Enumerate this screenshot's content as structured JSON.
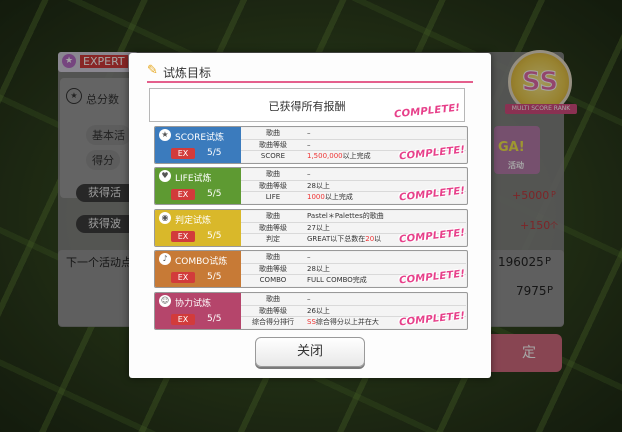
{
  "background": {
    "difficulty": "EXPERT",
    "score_title": "总分数",
    "pill_basic": "基本活",
    "pill_score": "得分",
    "btn_get_event": "获得活",
    "btn_get_wave": "获得波",
    "val_plus_5000": "+5000",
    "unit_p": "P",
    "val_plus_150": "+150",
    "unit_ge": "个",
    "next_event_label": "下一个活动点",
    "next_val_1": "196025",
    "next_val_2": "7975",
    "rank_badge": "SS",
    "rank_label": "MULTI SCORE RANK",
    "side_button_fragment": "定",
    "ad_text": "GA!",
    "ad_sub": "活动"
  },
  "modal": {
    "title": "试炼目标",
    "reward_text": "已获得所有报酬",
    "complete_label": "COMPLETE!",
    "close_label": "关闭"
  },
  "goals": [
    {
      "name": "SCORE试炼",
      "icon": "star-icon",
      "color": "#3b7bbd",
      "ex": "EX",
      "count": "5/5",
      "rows": [
        {
          "k": "歌曲",
          "v": "–"
        },
        {
          "k": "歌曲等级",
          "v": "–"
        },
        {
          "k": "SCORE",
          "v_red": "1,500,000",
          "v": "以上完成"
        }
      ]
    },
    {
      "name": "LIFE试炼",
      "icon": "heart-icon",
      "color": "#5e9a32",
      "ex": "EX",
      "count": "5/5",
      "rows": [
        {
          "k": "歌曲",
          "v": "–"
        },
        {
          "k": "歌曲等级",
          "v": "28以上"
        },
        {
          "k": "LIFE",
          "v_red": "1000",
          "v": "以上完成"
        }
      ]
    },
    {
      "name": "判定试炼",
      "icon": "target-icon",
      "color": "#d9b82a",
      "ex": "EX",
      "count": "5/5",
      "rows": [
        {
          "k": "歌曲",
          "v": "Pastel＊Palettes的歌曲"
        },
        {
          "k": "歌曲等级",
          "v": "27以上"
        },
        {
          "k": "判定",
          "v_pre": "GREAT以下总数在",
          "v_red": "20",
          "v": "以"
        }
      ]
    },
    {
      "name": "COMBO试炼",
      "icon": "note-icon",
      "color": "#c77a36",
      "ex": "EX",
      "count": "5/5",
      "rows": [
        {
          "k": "歌曲",
          "v": "–"
        },
        {
          "k": "歌曲等级",
          "v": "28以上"
        },
        {
          "k": "COMBO",
          "v": "FULL COMBO完成"
        }
      ]
    },
    {
      "name": "协力试炼",
      "icon": "people-icon",
      "color": "#b5456b",
      "ex": "EX",
      "count": "5/5",
      "rows": [
        {
          "k": "歌曲",
          "v": "–"
        },
        {
          "k": "歌曲等级",
          "v": "26以上"
        },
        {
          "k": "综合得分排行",
          "v_red": "SS",
          "v": "综合得分以上并在大"
        }
      ]
    }
  ]
}
